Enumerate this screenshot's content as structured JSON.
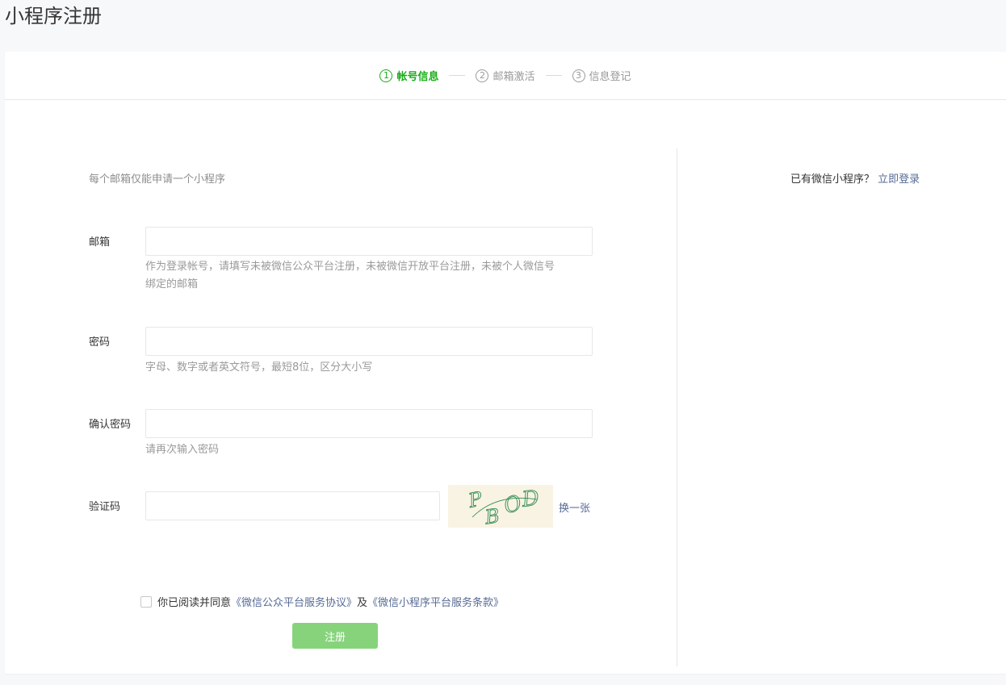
{
  "page": {
    "title": "小程序注册"
  },
  "steps": [
    {
      "num": "1",
      "label": "帐号信息",
      "active": true
    },
    {
      "num": "2",
      "label": "邮箱激活",
      "active": false
    },
    {
      "num": "3",
      "label": "信息登记",
      "active": false
    }
  ],
  "form": {
    "tip": "每个邮箱仅能申请一个小程序",
    "email": {
      "label": "邮箱",
      "value": "",
      "hint_line1": "作为登录帐号，请填写未被微信公众平台注册，未被微信开放平台注册，未被个人微信号",
      "hint_line2": "绑定的邮箱"
    },
    "password": {
      "label": "密码",
      "value": "",
      "hint": "字母、数字或者英文符号，最短8位，区分大小写"
    },
    "confirm": {
      "label": "确认密码",
      "value": "",
      "hint": "请再次输入密码"
    },
    "captcha": {
      "label": "验证码",
      "value": "",
      "change_link": "换一张",
      "image_text": "PBOD"
    },
    "agreement": {
      "prefix": "你已阅读并同意",
      "link1": "《微信公众平台服务协议》",
      "middle": "及",
      "link2": "《微信小程序平台服务条款》",
      "checked": false
    },
    "submit_label": "注册"
  },
  "sidebar": {
    "text": "已有微信小程序？",
    "login_link": "立即登录"
  },
  "colors": {
    "accent": "#1aad19",
    "button_disabled": "#87d37c",
    "link": "#576b95"
  }
}
